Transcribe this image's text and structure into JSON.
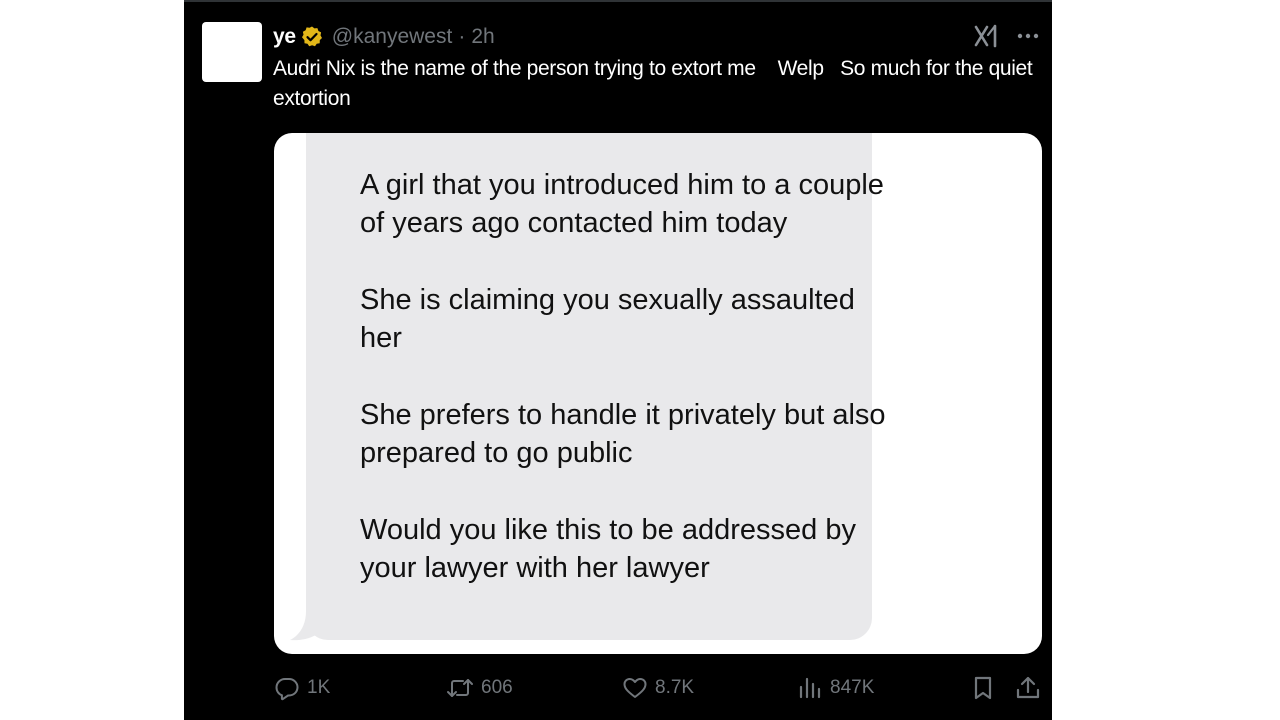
{
  "post": {
    "author_name": "ye",
    "handle": "@kanyewest",
    "separator": "·",
    "time": "2h",
    "text": "Audri Nix is the name of the person trying to extort me    Welp   So much for the quiet extortion"
  },
  "icons": {
    "verified": "verified-badge-icon",
    "grok": "grok-icon",
    "more": "more-icon",
    "reply": "reply-icon",
    "retweet": "retweet-icon",
    "like": "heart-icon",
    "views": "analytics-icon",
    "bookmark": "bookmark-icon",
    "share": "share-icon"
  },
  "media": {
    "message_paragraphs": [
      "A girl that you introduced him to a couple of years ago contacted him today",
      "She is claiming you sexually assaulted her",
      "She prefers to handle it privately but also prepared to go public",
      "Would you like this to be addressed by your lawyer with her lawyer"
    ]
  },
  "actions": {
    "replies": "1K",
    "reposts": "606",
    "likes": "8.7K",
    "views": "847K"
  },
  "colors": {
    "background": "#000000",
    "text": "#e7e9ea",
    "muted": "#71767b",
    "verified_gold": "#e2b719",
    "bubble": "#e9e9eb",
    "page": "#ffffff"
  }
}
